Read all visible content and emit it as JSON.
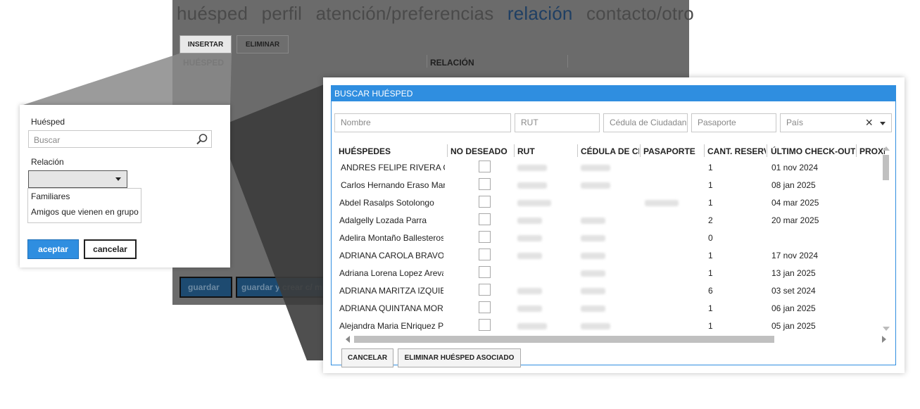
{
  "background_window": {
    "tabs": [
      "huésped",
      "perfil",
      "atención/preferencias",
      "relación",
      "contacto/otro"
    ],
    "active_tab": "relación",
    "insert_label": "INSERTAR",
    "delete_label": "ELIMINAR",
    "col_guest": "HUÉSPED",
    "col_relation": "RELACIÓN",
    "save_label": "guardar",
    "save_create_label": "guardar y crear c/ mis"
  },
  "relation_popup": {
    "guest_label": "Huésped",
    "search_placeholder": "Buscar",
    "relation_label": "Relación",
    "options": [
      "Familiares",
      "Amigos que vienen en grupo"
    ],
    "accept_label": "aceptar",
    "cancel_label": "cancelar"
  },
  "search_dialog": {
    "title": "BUSCAR HUÉSPED",
    "filters": {
      "name": "Nombre",
      "rut": "RUT",
      "cedula": "Cédula de Ciudadan",
      "passport": "Pasaporte",
      "country": "País"
    },
    "columns": [
      "HUÉSPEDES",
      "NO DESEADO",
      "RUT",
      "CÉDULA DE CIU",
      "PASAPORTE",
      "CANT. RESERVA",
      "ÚLTIMO CHECK-OUT",
      "PROXI"
    ],
    "rows": [
      {
        "name": "ANDRES FELIPE RIVERA COI",
        "count": "1",
        "checkout": "01 nov 2024"
      },
      {
        "name": "Carlos Hernando Eraso Mar",
        "count": "1",
        "checkout": "08 jan 2025"
      },
      {
        "name": "Abdel Rasalps Sotolongo",
        "count": "1",
        "checkout": "04 mar 2025"
      },
      {
        "name": "Adalgelly Lozada Parra",
        "count": "2",
        "checkout": "20 mar 2025"
      },
      {
        "name": "Adelira Montaño Ballesteros",
        "count": "0",
        "checkout": ""
      },
      {
        "name": "ADRIANA CAROLA BRAVO E",
        "count": "1",
        "checkout": "17 nov 2024"
      },
      {
        "name": "Adriana Lorena Lopez Areva",
        "count": "1",
        "checkout": "13 jan 2025"
      },
      {
        "name": "ADRIANA MARITZA IZQUIEF",
        "count": "6",
        "checkout": "03 set 2024"
      },
      {
        "name": "ADRIANA QUINTANA MORE",
        "count": "1",
        "checkout": "06 jan 2025"
      },
      {
        "name": "Alejandra Maria ENriquez Pa",
        "count": "1",
        "checkout": "05 jan 2025"
      }
    ],
    "cancel_label": "CANCELAR",
    "remove_label": "ELIMINAR HUÉSPED ASOCIADO"
  },
  "colors": {
    "accent": "#2f8ee0",
    "active_tab": "#1f3f63",
    "dim_overlay": "#6b6b6b"
  }
}
